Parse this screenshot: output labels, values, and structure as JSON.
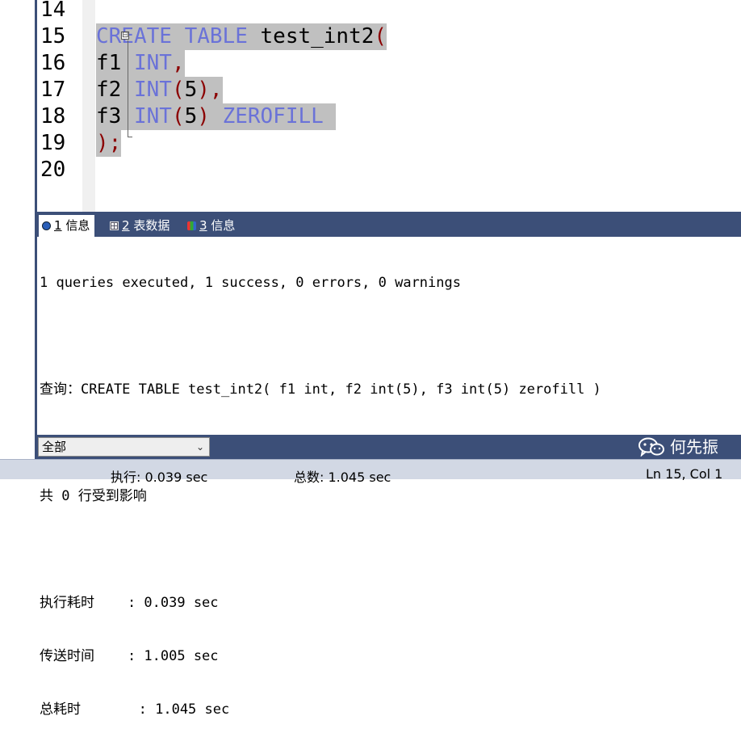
{
  "editor": {
    "lines": [
      {
        "num": "14"
      },
      {
        "num": "15",
        "tokens": [
          {
            "t": "CREATE",
            "c": "kw"
          },
          {
            "t": " ",
            "c": "id"
          },
          {
            "t": "TABLE",
            "c": "kw"
          },
          {
            "t": " test_int2",
            "c": "id"
          },
          {
            "t": "(",
            "c": "pn"
          }
        ]
      },
      {
        "num": "16",
        "tokens": [
          {
            "t": "f1 ",
            "c": "id"
          },
          {
            "t": "INT",
            "c": "kw"
          },
          {
            "t": ",",
            "c": "pn"
          }
        ]
      },
      {
        "num": "17",
        "tokens": [
          {
            "t": "f2 ",
            "c": "id"
          },
          {
            "t": "INT",
            "c": "kw"
          },
          {
            "t": "(",
            "c": "pn"
          },
          {
            "t": "5",
            "c": "id"
          },
          {
            "t": ")",
            "c": "pn"
          },
          {
            "t": ",",
            "c": "pn"
          }
        ]
      },
      {
        "num": "18",
        "tokens": [
          {
            "t": "f3 ",
            "c": "id"
          },
          {
            "t": "INT",
            "c": "kw"
          },
          {
            "t": "(",
            "c": "pn"
          },
          {
            "t": "5",
            "c": "id"
          },
          {
            "t": ")",
            "c": "pn"
          },
          {
            "t": " ",
            "c": "id"
          },
          {
            "t": "ZEROFILL",
            "c": "kw"
          },
          {
            "t": " ",
            "c": "id"
          }
        ]
      },
      {
        "num": "19",
        "tokens": [
          {
            "t": ")",
            "c": "pn"
          },
          {
            "t": ";",
            "c": "pn"
          }
        ]
      },
      {
        "num": "20"
      }
    ],
    "fold_marker": "⊟"
  },
  "result_tabs": [
    {
      "num": "1",
      "label": "信息",
      "icon": "info-icon"
    },
    {
      "num": "2",
      "label": "表数据",
      "icon": "table-grid-icon"
    },
    {
      "num": "3",
      "label": "信息",
      "icon": "messages-icon"
    }
  ],
  "messages": {
    "summary": "1 queries executed, 1 success, 0 errors, 0 warnings",
    "query": "查询：CREATE TABLE test_int2( f1 int, f2 int(5), f3 int(5) zerofill )",
    "affected": "共 0 行受到影响",
    "exec_time": "执行耗时    : 0.039 sec",
    "transfer_time": "传送时间    : 1.005 sec",
    "total_time": "总耗时       : 1.045 sec"
  },
  "scope_select": {
    "value": "全部",
    "chevron": "⌄"
  },
  "watermark": {
    "text": "何先振",
    "icon": "wechat-icon"
  },
  "status": {
    "exec": "执行: 0.039 sec",
    "total": "总数: 1.045 sec",
    "position": "Ln 15, Col 1"
  },
  "colors": {
    "keyword": "#6a72d8",
    "paren": "#8b0000",
    "selection": "#c0c0c0",
    "panel_bar": "#3c4f78",
    "statusbar": "#d2d8e4"
  }
}
